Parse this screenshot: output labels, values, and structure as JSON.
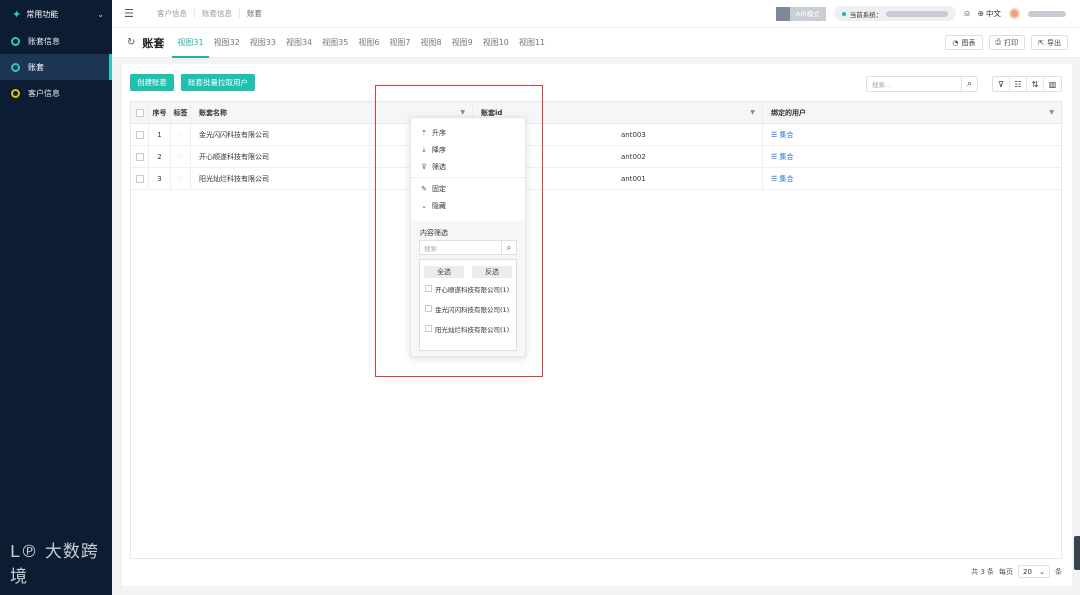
{
  "sidebar": {
    "header": "常用功能",
    "items": [
      {
        "label": "账套信息",
        "active": false
      },
      {
        "label": "账套",
        "active": true
      },
      {
        "label": "客户信息",
        "active": false
      }
    ],
    "watermark": "大数跨境"
  },
  "topbar": {
    "breadcrumbs": [
      "客户信息",
      "账套信息",
      "账套"
    ],
    "air_mode": "AIR模式",
    "system_label": "当前系统：",
    "lang": "中文"
  },
  "viewbar": {
    "title": "账套",
    "tabs": [
      "视图31",
      "视图32",
      "视图33",
      "视图34",
      "视图35",
      "视图6",
      "视图7",
      "视图8",
      "视图9",
      "视图10",
      "视图11"
    ],
    "active_tab": "视图31",
    "chart_btn": "图表",
    "print_btn": "打印",
    "export_btn": "导出"
  },
  "toolbar": {
    "create_btn": "创建账套",
    "batch_btn": "账套批量拉取用户",
    "search_placeholder": "搜索..."
  },
  "table": {
    "headers": {
      "no": "序号",
      "tag": "标签",
      "name": "账套名称",
      "id": "账套id",
      "user": "绑定的用户"
    },
    "rows": [
      {
        "no": "1",
        "name": "金光闪闪科技有限公司",
        "id": "ant003",
        "user": "集合"
      },
      {
        "no": "2",
        "name": "开心顺遂科技有限公司",
        "id": "ant002",
        "user": "集合"
      },
      {
        "no": "3",
        "name": "阳光灿烂科技有限公司",
        "id": "ant001",
        "user": "集合"
      }
    ]
  },
  "pager": {
    "total": "共 3 条",
    "per_page_label": "每页",
    "per_page": "20",
    "unit": "条"
  },
  "popup": {
    "asc": "升序",
    "desc": "降序",
    "filter": "筛选",
    "pin": "固定",
    "hide": "隐藏",
    "section_title": "内容筛选",
    "search_placeholder": "搜索",
    "select_all": "全选",
    "invert": "反选",
    "options": [
      "开心顺遂科技有限公司(1)",
      "金光闪闪科技有限公司(1)",
      "阳光灿烂科技有限公司(1)"
    ]
  },
  "colors": {
    "accent": "#1fc0ae",
    "sidebar_bg": "#0c1d33",
    "highlight": "#e03b3b"
  }
}
